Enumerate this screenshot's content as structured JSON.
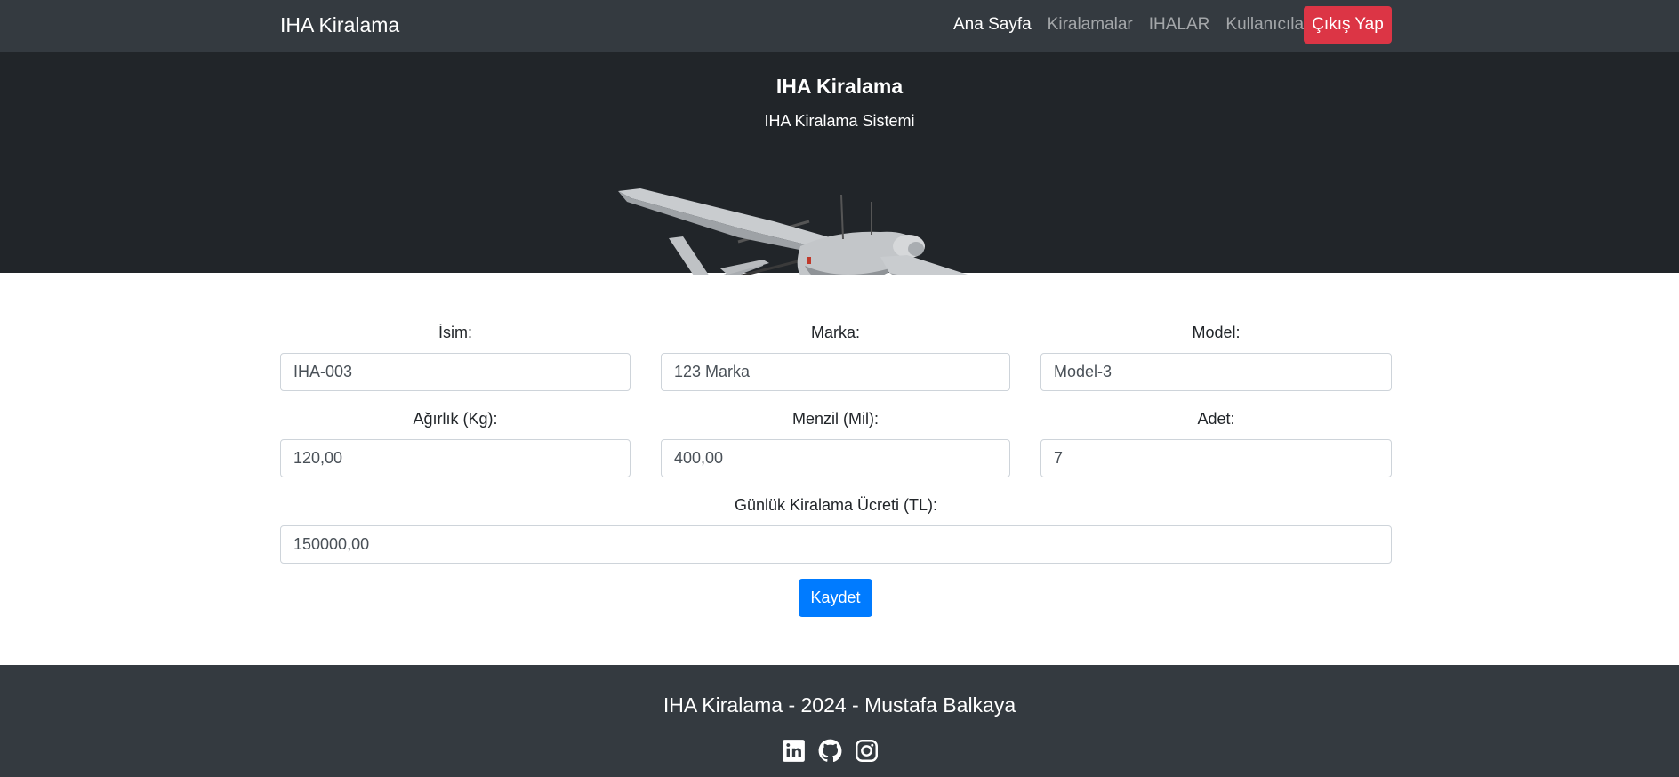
{
  "navbar": {
    "brand": "IHA Kiralama",
    "links": [
      {
        "label": "Ana Sayfa"
      },
      {
        "label": "Kiralamalar"
      },
      {
        "label": "IHALAR"
      },
      {
        "label": "Kullanıcılar"
      }
    ],
    "logout_label": "Çıkış Yap"
  },
  "hero": {
    "title": "IHA Kiralama",
    "subtitle": "IHA Kiralama Sistemi"
  },
  "form": {
    "name": {
      "label": "İsim:",
      "value": "IHA-003"
    },
    "brand": {
      "label": "Marka:",
      "value": "123 Marka"
    },
    "model": {
      "label": "Model:",
      "value": "Model-3"
    },
    "weight": {
      "label": "Ağırlık (Kg):",
      "value": "120,00"
    },
    "range": {
      "label": "Menzil (Mil):",
      "value": "400,00"
    },
    "quantity": {
      "label": "Adet:",
      "value": "7"
    },
    "daily_fee": {
      "label": "Günlük Kiralama Ücreti (TL):",
      "value": "150000,00"
    },
    "save_label": "Kaydet"
  },
  "footer": {
    "text": "IHA Kiralama - 2024 - Mustafa Balkaya",
    "social_icons": [
      "linkedin-icon",
      "github-icon",
      "instagram-icon"
    ]
  },
  "colors": {
    "navbar_bg": "#343a40",
    "hero_bg": "#212529",
    "logout_button": "#dc3545",
    "save_button": "#007bff"
  }
}
